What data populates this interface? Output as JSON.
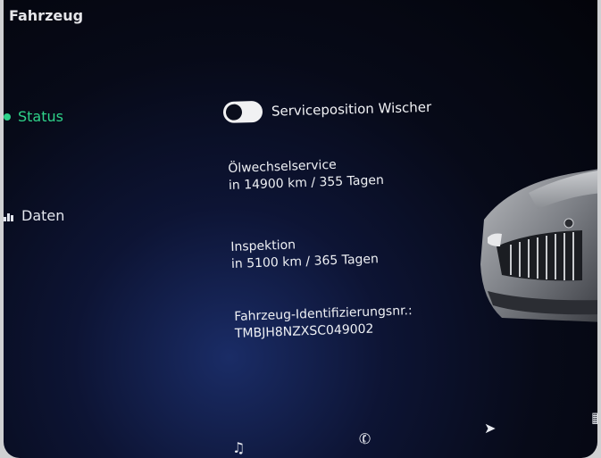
{
  "header": {
    "title": "Fahrzeug"
  },
  "sidebar": {
    "items": [
      {
        "label": "Status"
      },
      {
        "label": "Daten"
      }
    ]
  },
  "main": {
    "toggle": {
      "label": "Serviceposition Wischer",
      "state": "off"
    },
    "oil_service": {
      "title": "Ölwechselservice",
      "value": "in 14900 km / 355 Tagen"
    },
    "inspection": {
      "title": "Inspektion",
      "value": "in 5100 km / 365 Tagen"
    },
    "vin": {
      "title": "Fahrzeug-Identifizierungsnr.:",
      "value": "TMBJH8NZXSC049002"
    }
  },
  "colors": {
    "accent": "#2fd38a",
    "background": "#070a18",
    "text": "#eef0f4"
  },
  "bottom_icons": [
    "music-icon",
    "phone-icon",
    "navigation-icon",
    "apps-grid-icon"
  ]
}
